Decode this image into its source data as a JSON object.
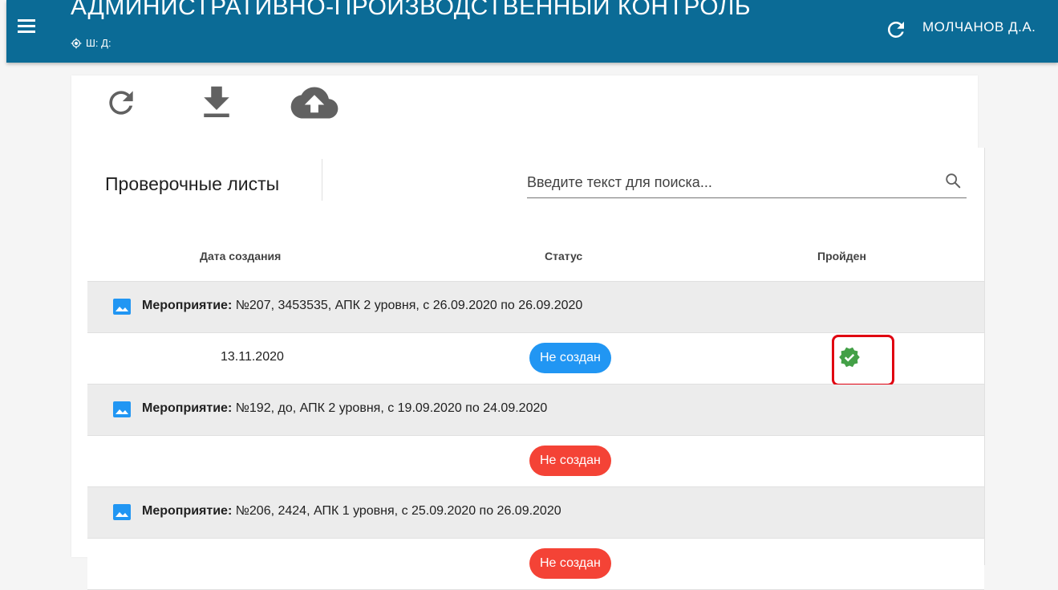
{
  "header": {
    "title": "АДМИНИСТРАТИВНО-ПРОИЗВОДСТВЕННЫЙ КОНТРОЛЬ",
    "subtitle": "Ш: Д:",
    "user": "МОЛЧАНОВ Д.А.",
    "bar_color": "#0b6b96"
  },
  "toolbar": {
    "refresh_icon": "refresh-icon",
    "download_icon": "download-icon",
    "upload_icon": "cloud-upload-icon"
  },
  "panel": {
    "title": "Проверочные листы",
    "search_placeholder": "Введите текст для поиска..."
  },
  "table": {
    "columns": [
      "Дата создания",
      "Статус",
      "Пройден"
    ],
    "rows": [
      {
        "group_label": "Мероприятие:",
        "group_text": " №207, 3453535, АПК 2 уровня, с 26.09.2020 по 26.09.2020",
        "date": "13.11.2020",
        "status": "Не создан",
        "status_color": "#2196f3",
        "passed": true
      },
      {
        "group_label": "Мероприятие:",
        "group_text": " №192, до, АПК 2 уровня, с 19.09.2020 по 24.09.2020",
        "date": "",
        "status": "Не создан",
        "status_color": "#f44336",
        "passed": false
      },
      {
        "group_label": "Мероприятие:",
        "group_text": " №206, 2424, АПК 1 уровня, с 25.09.2020 по 26.09.2020",
        "date": "",
        "status": "Не создан",
        "status_color": "#f44336",
        "passed": false
      }
    ]
  },
  "colors": {
    "passed_green": "#43a047",
    "highlight_red": "#e00010",
    "group_icon_blue": "#2196f3"
  }
}
